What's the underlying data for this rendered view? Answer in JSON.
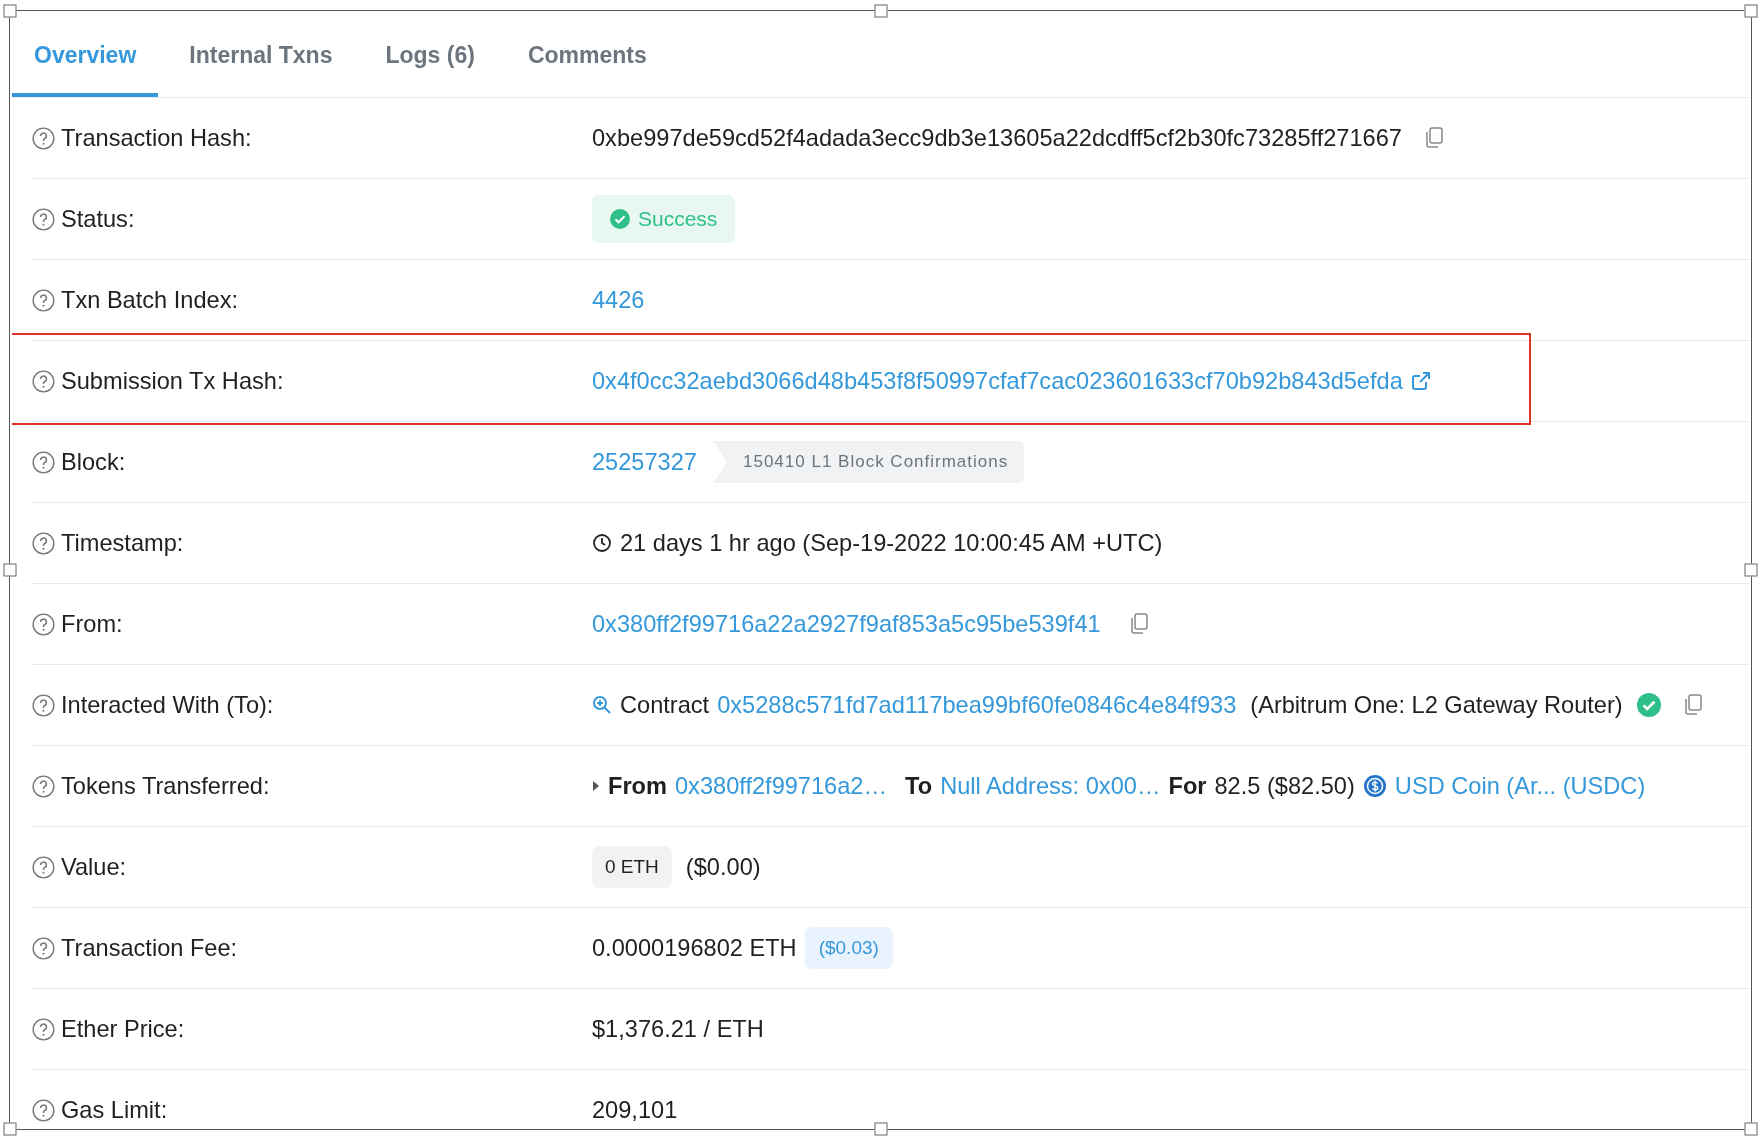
{
  "tabs": [
    {
      "label": "Overview",
      "selected": true
    },
    {
      "label": "Internal Txns",
      "selected": false
    },
    {
      "label": "Logs (6)",
      "selected": false
    },
    {
      "label": "Comments",
      "selected": false
    }
  ],
  "rows": [
    {
      "label": "Transaction Hash:",
      "kind": "copy_text",
      "highlighted": false,
      "text": "0xbe997de59cd52f4adada3ecc9db3e13605a22dcdff5cf2b30fc73285ff271667"
    },
    {
      "label": "Status:",
      "kind": "status",
      "highlighted": false,
      "text": "Success"
    },
    {
      "label": "Txn Batch Index:",
      "kind": "link",
      "highlighted": false,
      "text": "4426"
    },
    {
      "label": "Submission Tx Hash:",
      "kind": "external_link",
      "highlighted": true,
      "text": "0x4f0cc32aebd3066d48b453f8f50997cfaf7cac023601633cf70b92b843d5efda"
    },
    {
      "label": "Block:",
      "kind": "block",
      "highlighted": false,
      "text": "25257327",
      "badge": "150410 L1 Block Confirmations"
    },
    {
      "label": "Timestamp:",
      "kind": "timestamp",
      "highlighted": false,
      "text": "21 days 1 hr ago (Sep-19-2022 10:00:45 AM +UTC)"
    },
    {
      "label": "From:",
      "kind": "copy_link",
      "highlighted": false,
      "text": "0x380ff2f99716a22a2927f9af853a5c95be539f41"
    },
    {
      "label": "Interacted With (To):",
      "kind": "contract",
      "highlighted": false,
      "prefix": "Contract",
      "text": "0x5288c571fd7ad117bea99bf60fe0846c4e84f933",
      "note": "(Arbitrum One: L2 Gateway Router)",
      "verified": true
    },
    {
      "label": "Tokens Transferred:",
      "kind": "tokens",
      "highlighted": false,
      "from_label": "From",
      "from": "0x380ff2f99716a2…",
      "to_label": "To",
      "to": "Null Address: 0x00…",
      "for_label": "For",
      "amount": "82.5 ($82.50)",
      "token": "USD Coin (Ar... (USDC)"
    },
    {
      "label": "Value:",
      "kind": "value",
      "highlighted": false,
      "badge": "0 ETH",
      "text": "($0.00)"
    },
    {
      "label": "Transaction Fee:",
      "kind": "fee",
      "highlighted": false,
      "text": "0.0000196802 ETH",
      "badge": "($0.03)"
    },
    {
      "label": "Ether Price:",
      "kind": "text",
      "highlighted": false,
      "text": "$1,376.21 / ETH"
    },
    {
      "label": "Gas Limit:",
      "kind": "text",
      "highlighted": false,
      "text": "209,101"
    }
  ]
}
